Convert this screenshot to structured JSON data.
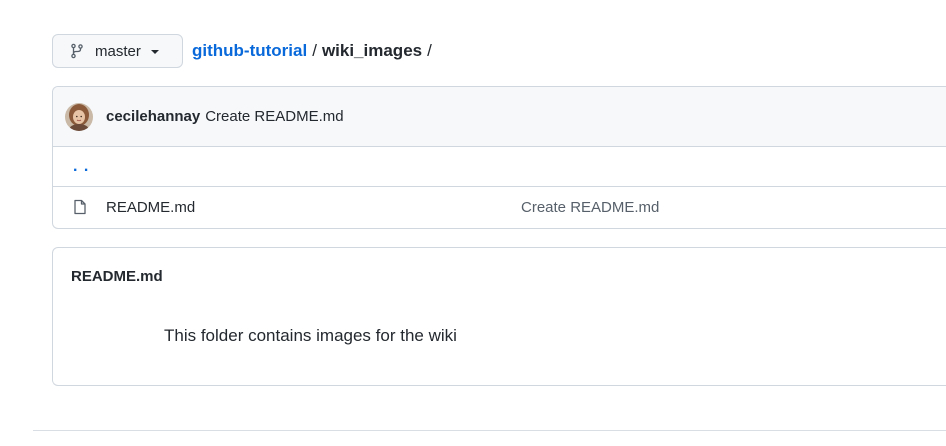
{
  "branch": {
    "label": "master",
    "icon": "git-branch-icon",
    "dropdown_icon": "caret-down-icon"
  },
  "breadcrumb": {
    "repo": "github-tutorial",
    "separator_1": "/",
    "folder": "wiki_images",
    "separator_2": "/"
  },
  "commit_header": {
    "author": "cecilehannay",
    "message": "Create README.md"
  },
  "parent_dir": {
    "label": ". ."
  },
  "files": [
    {
      "icon": "file-icon",
      "name": "README.md",
      "commit_message": "Create README.md"
    }
  ],
  "readme": {
    "title": "README.md",
    "body": "This folder contains images for the wiki"
  },
  "colors": {
    "link": "#0969da",
    "border": "#d0d7de",
    "header_bg": "#f6f8fa",
    "text": "#24292f",
    "muted": "#57606a"
  }
}
